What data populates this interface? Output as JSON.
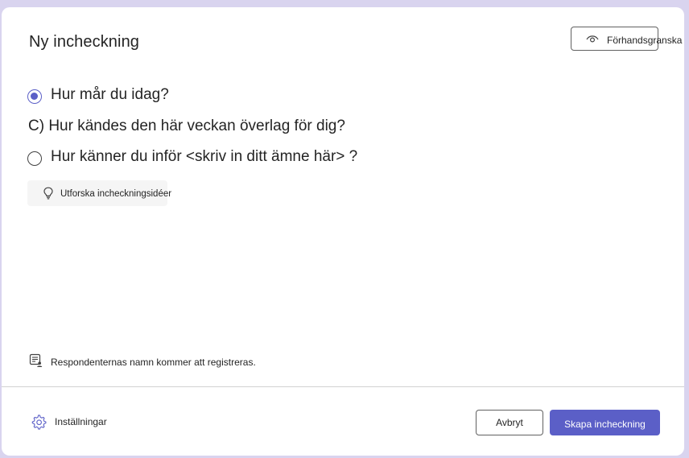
{
  "dialog": {
    "title": "Ny incheckning",
    "preview_label": "Förhandsgranska"
  },
  "questions": [
    {
      "text": "Hur mår du idag?",
      "selected": true
    },
    {
      "text": "C) Hur kändes den här veckan överlag för dig?",
      "selected": false
    },
    {
      "text": "Hur känner du inför <skriv in ditt ämne här> ?",
      "selected": false
    }
  ],
  "explore_label": "Utforska incheckningsidéer",
  "notice": "Respondenternas namn kommer att registreras.",
  "footer": {
    "settings_label": "Inställningar",
    "cancel_label": "Avbryt",
    "create_label": "Skapa incheckning"
  },
  "colors": {
    "accent": "#5b5fc7",
    "backdrop": "#d9d4ef"
  },
  "icons": {
    "preview": "eye-icon",
    "explore": "lightbulb-icon",
    "notice": "form-person-icon",
    "settings": "gear-icon"
  }
}
